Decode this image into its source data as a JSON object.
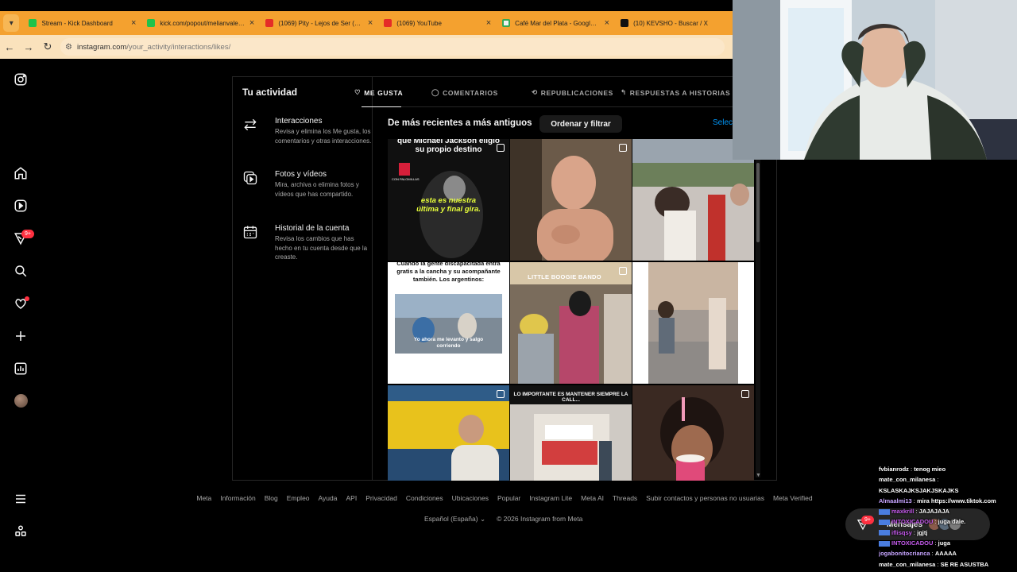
{
  "browser": {
    "tabs": [
      {
        "title": "Stream - Kick Dashboard",
        "favicon": "kick-icon"
      },
      {
        "title": "kick.com/popout/melianvalen/c",
        "favicon": "kick-icon"
      },
      {
        "title": "(1069) Pity - Lejos de Ser (video",
        "favicon": "youtube-icon"
      },
      {
        "title": "(1069) YouTube",
        "favicon": "youtube-icon"
      },
      {
        "title": "Café Mar del Plata - Google Ma",
        "favicon": "maps-icon"
      },
      {
        "title": "(10) KEVSHO - Buscar / X",
        "favicon": "x-icon"
      }
    ],
    "url_host": "instagram.com",
    "url_path": "/your_activity/interactions/likes/",
    "colors": {
      "tabbar": "#f4a12f",
      "addressbar": "#fae2bc"
    }
  },
  "activity": {
    "title": "Tu actividad",
    "menu": [
      {
        "title": "Interacciones",
        "desc": "Revisa y elimina los Me gusta, los comentarios y otras interacciones.",
        "icon": "arrows-swap-icon"
      },
      {
        "title": "Fotos y vídeos",
        "desc": "Mira, archiva o elimina fotos y vídeos que has compartido.",
        "icon": "photos-icon"
      },
      {
        "title": "Historial de la cuenta",
        "desc": "Revisa los cambios que has hecho en tu cuenta desde que la creaste.",
        "icon": "calendar-icon"
      }
    ],
    "tabs": [
      {
        "label": "ME GUSTA",
        "icon": "heart-icon",
        "active": true
      },
      {
        "label": "COMENTARIOS",
        "icon": "comment-icon",
        "active": false
      },
      {
        "label": "REPUBLICACIONES",
        "icon": "repost-icon",
        "active": false
      },
      {
        "label": "RESPUESTAS A HISTORIAS",
        "icon": "reply-icon",
        "active": false
      }
    ],
    "sort_label": "De más recientes a más antiguos",
    "sort_button": "Ordenar y filtrar",
    "select_label": "Seleccionar",
    "grid_captions": {
      "c1_top": "que Michael Jackson eligió su propio destino",
      "c1_mid": "esta es nuestra última y final gira.",
      "c1_brand": "CON PALOMILLAS",
      "c4_top": "Cuando la gente discapacitada entra gratis a la cancha y su acompañante también. Los argentinos:",
      "c4_sub": "Yo ahora me levanto y salgo corriendo",
      "c5_top": "LITTLE BOOGIE BANDO",
      "c8_top": "LO IMPORTANTE ES MANTENER SIEMPRE LA CALL..."
    }
  },
  "footer": {
    "links": [
      "Meta",
      "Información",
      "Blog",
      "Empleo",
      "Ayuda",
      "API",
      "Privacidad",
      "Condiciones",
      "Ubicaciones",
      "Popular",
      "Instagram Lite",
      "Meta AI",
      "Threads",
      "Subir contactos y personas no usuarias",
      "Meta Verified"
    ],
    "language": "Español (España)",
    "copyright": "© 2026 Instagram from Meta"
  },
  "messages": {
    "label": "Mensajes",
    "badge": "9+"
  },
  "sidebar": {
    "notifications_badge": "9+"
  },
  "chat": [
    {
      "user": "fvbianrodz",
      "color": "#ffffff",
      "text": "tenog mieo"
    },
    {
      "user": "mate_con_milanesa",
      "color": "#ffffff",
      "text": ""
    },
    {
      "user": "",
      "color": "#ffffff",
      "text": "KSLASKAJKSJAKJSKAJKS"
    },
    {
      "user": "Almaalmi13",
      "color": "#c6a4ff",
      "text": "mira https://www.tiktok.com"
    },
    {
      "user": "maxkrill",
      "color": "#c85cf0",
      "text": "JAJAJAJA"
    },
    {
      "user": "INTOXICADOU",
      "color": "#c85cf0",
      "text": "juga dale."
    },
    {
      "user": "iflisqsy",
      "color": "#c85cf0",
      "text": "jgjtj"
    },
    {
      "user": "INTOXICADOU",
      "color": "#c85cf0",
      "text": "juga"
    },
    {
      "user": "jogabonitocrianca",
      "color": "#c6a4ff",
      "text": "AAAAA"
    },
    {
      "user": "mate_con_milanesa",
      "color": "#ffffff",
      "text": "SE RE ASUSTBA"
    }
  ]
}
